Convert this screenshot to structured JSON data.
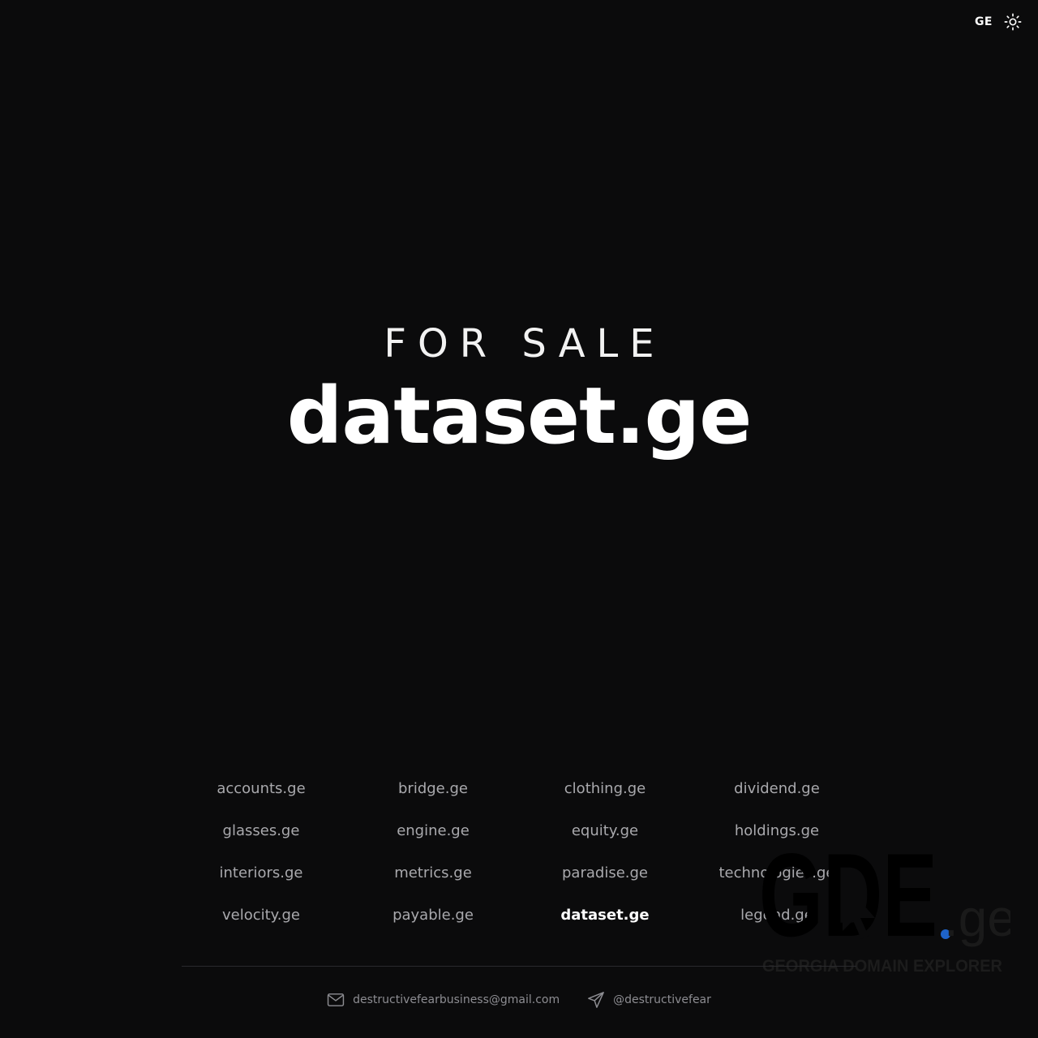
{
  "header": {
    "language_label": "GE",
    "theme_icon": "sun-icon"
  },
  "hero": {
    "eyebrow": "FOR SALE",
    "domain": "dataset.ge"
  },
  "domains": [
    {
      "name": "accounts.ge",
      "current": false
    },
    {
      "name": "bridge.ge",
      "current": false
    },
    {
      "name": "clothing.ge",
      "current": false
    },
    {
      "name": "dividend.ge",
      "current": false
    },
    {
      "name": "glasses.ge",
      "current": false
    },
    {
      "name": "engine.ge",
      "current": false
    },
    {
      "name": "equity.ge",
      "current": false
    },
    {
      "name": "holdings.ge",
      "current": false
    },
    {
      "name": "interiors.ge",
      "current": false
    },
    {
      "name": "metrics.ge",
      "current": false
    },
    {
      "name": "paradise.ge",
      "current": false
    },
    {
      "name": "technologies.ge",
      "current": false
    },
    {
      "name": "velocity.ge",
      "current": false
    },
    {
      "name": "payable.ge",
      "current": false
    },
    {
      "name": "dataset.ge",
      "current": true
    },
    {
      "name": "legend.ge",
      "current": false
    }
  ],
  "watermark": {
    "logo_text": "GDE",
    "logo_suffix": ".ge",
    "tagline": "GEORGIA DOMAIN EXPLORER"
  },
  "footer": {
    "email": "destructivefearbusiness@gmail.com",
    "telegram": "@destructivefear"
  },
  "colors": {
    "background": "#0b0b0c",
    "text": "#ffffff",
    "muted": "#a9a9ad",
    "watermark_dot": "#1e63c9"
  }
}
